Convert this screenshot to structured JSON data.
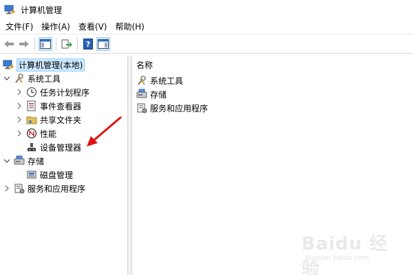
{
  "window": {
    "title": "计算机管理"
  },
  "menu": [
    "文件(F)",
    "操作(A)",
    "查看(V)",
    "帮助(H)"
  ],
  "tree": {
    "root": "计算机管理(本地)",
    "system_tools": "系统工具",
    "task_scheduler": "任务计划程序",
    "event_viewer": "事件查看器",
    "shared_folders": "共享文件夹",
    "performance": "性能",
    "device_manager": "设备管理器",
    "storage": "存储",
    "disk_management": "磁盘管理",
    "services_apps": "服务和应用程序"
  },
  "list": {
    "header": "名称",
    "items": [
      "系统工具",
      "存储",
      "服务和应用程序"
    ]
  },
  "watermark": {
    "brand": "Baidu 经验",
    "sub": "jingyan.baidu.com"
  },
  "colors": {
    "selection": "#cce8ff",
    "selection_border": "#99d1ff",
    "annotation_arrow": "#e01010"
  }
}
